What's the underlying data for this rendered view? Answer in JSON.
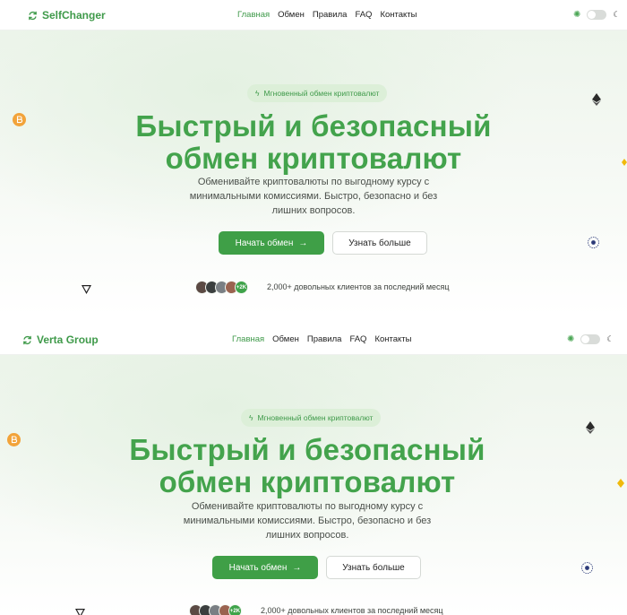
{
  "panels": [
    {
      "brand": "SelfChanger",
      "nav": [
        "Главная",
        "Обмен",
        "Правила",
        "FAQ",
        "Контакты"
      ],
      "badge": "Мгновенный обмен криптовалют",
      "title_line1": "Быстрый и безопасный",
      "title_line2": "обмен криптовалют",
      "subtitle_line1": "Обменивайте криптовалюты по выгодному курсу с",
      "subtitle_line2": "минимальными комиссиями. Быстро, безопасно и без",
      "subtitle_line3": "лишних вопросов.",
      "cta_primary": "Начать обмен",
      "cta_secondary": "Узнать больше",
      "avatar_count": "+2K",
      "clients": "2,000+ довольных клиентов за последний месяц"
    },
    {
      "brand": "Verta Group",
      "nav": [
        "Главная",
        "Обмен",
        "Правила",
        "FAQ",
        "Контакты"
      ],
      "badge": "Мгновенный обмен криптовалют",
      "title_line1": "Быстрый и безопасный",
      "title_line2": "обмен криптовалют",
      "subtitle_line1": "Обменивайте криптовалюты по выгодному курсу с",
      "subtitle_line2": "минимальными комиссиями. Быстро, безопасно и без",
      "subtitle_line3": "лишних вопросов.",
      "cta_primary": "Начать обмен",
      "cta_secondary": "Узнать больше",
      "avatar_count": "+2K",
      "clients": "2,000+ довольных клиентов за последний месяц"
    }
  ],
  "colors": {
    "accent": "#43a34c",
    "button": "#3f9f47",
    "badge_bg": "#dcefd8"
  },
  "icons": [
    "refresh-icon",
    "bolt-icon",
    "arrow-right-icon",
    "sun-icon",
    "moon-icon",
    "bitcoin-icon",
    "ethereum-icon",
    "tron-icon",
    "cosmos-icon",
    "bnb-icon"
  ]
}
